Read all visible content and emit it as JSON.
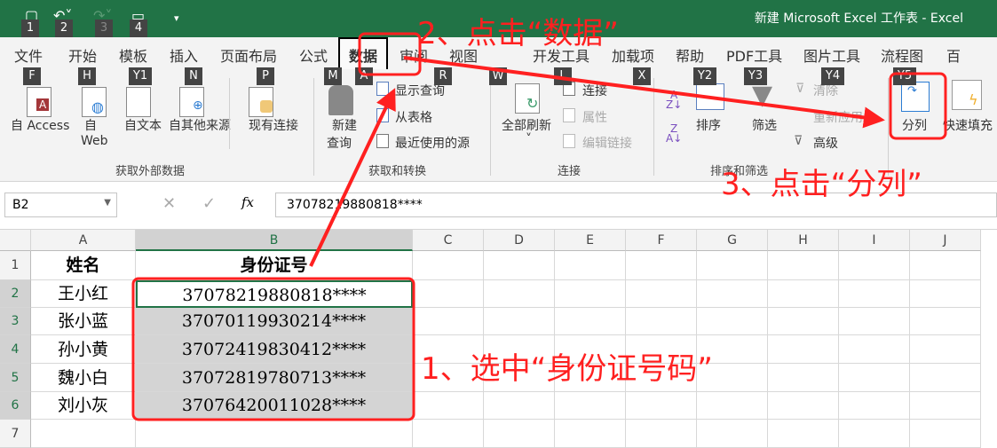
{
  "title": "新建 Microsoft Excel 工作表  -  Excel",
  "qat": {
    "keys": [
      "1",
      "2",
      "3",
      "4"
    ]
  },
  "tabs": [
    "文件",
    "开始",
    "模板",
    "插入",
    "页面布局",
    "公式",
    "数据",
    "审阅",
    "视图",
    "开发工具",
    "加载项",
    "帮助",
    "PDF工具",
    "图片工具",
    "流程图",
    "百"
  ],
  "keytips": [
    "F",
    "H",
    "Y1",
    "N",
    "P",
    "M",
    "A",
    "R",
    "W",
    "L",
    "X",
    "Y2",
    "Y3",
    "Y4",
    "Y5"
  ],
  "ribbon": {
    "from_access": "自 Access",
    "from_web_1": "自",
    "from_web_2": "Web",
    "from_text": "自文本",
    "from_other": "自其他来源",
    "existing": "现有连接",
    "group1": "获取外部数据",
    "new_query_1": "新建",
    "new_query_2": "查询",
    "show_queries": "显示查询",
    "from_table": "从表格",
    "recent_sources": "最近使用的源",
    "group2": "获取和转换",
    "refresh_all": "全部刷新",
    "connections": "连接",
    "properties": "属性",
    "edit_links": "编辑链接",
    "group3": "连接",
    "sort": "排序",
    "filter": "筛选",
    "clear": "清除",
    "reapply": "重新应用",
    "advanced": "高级",
    "group4": "排序和筛选",
    "text_to_columns": "分列",
    "flash_fill": "快速填充"
  },
  "formula": {
    "namebox": "B2",
    "fx": "fx",
    "value": "37078219880818****"
  },
  "columns": [
    "A",
    "B",
    "C",
    "D",
    "E",
    "F",
    "G",
    "H",
    "I",
    "J"
  ],
  "rows": [
    {
      "n": "1",
      "a": "姓名",
      "b": "身份证号"
    },
    {
      "n": "2",
      "a": "王小红",
      "b": "37078219880818****"
    },
    {
      "n": "3",
      "a": "张小蓝",
      "b": "37070119930214****"
    },
    {
      "n": "4",
      "a": "孙小黄",
      "b": "37072419830412****"
    },
    {
      "n": "5",
      "a": "魏小白",
      "b": "37072819780713****"
    },
    {
      "n": "6",
      "a": "刘小灰",
      "b": "37076420011028****"
    },
    {
      "n": "7",
      "a": "",
      "b": ""
    }
  ],
  "annotations": {
    "step1": "1、选中“身份证号码”",
    "step2": "2、点击“数据”",
    "step3": "3、点击“分列”"
  },
  "colors": {
    "excel_green": "#217346",
    "annotation_red": "#ff2020",
    "selection_gray": "#d4d4d4"
  }
}
